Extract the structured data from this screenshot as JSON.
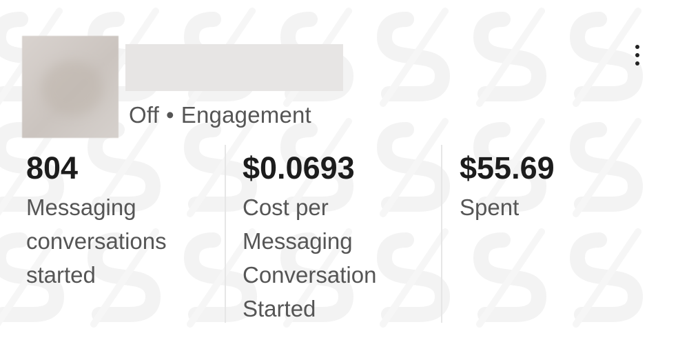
{
  "campaign": {
    "status": "Off",
    "separator": "•",
    "objective": "Engagement"
  },
  "icons": {
    "menu": "more-vertical-icon"
  },
  "metrics": [
    {
      "value": "804",
      "label": "Messaging conversations started"
    },
    {
      "value": "$0.0693",
      "label": "Cost per Messaging Conversation Started"
    },
    {
      "value": "$55.69",
      "label": "Spent"
    }
  ],
  "colors": {
    "value_text": "#1c1c1c",
    "label_text": "#555555",
    "divider": "#e6e6e6"
  }
}
